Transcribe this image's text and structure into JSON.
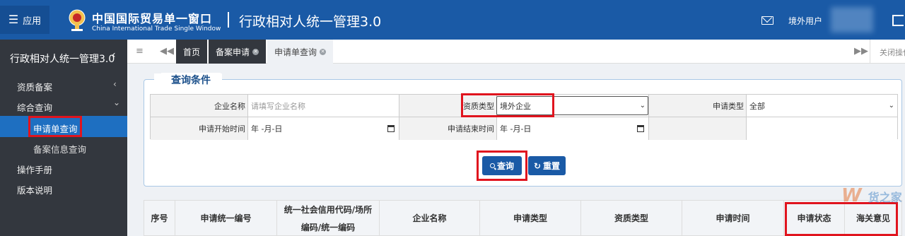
{
  "topbar": {
    "app_label": "应用",
    "brand_cn": "中国国际贸易单一窗口",
    "brand_en": "China International Trade Single Window",
    "system_title": "行政相对人统一管理3.0",
    "user_label": "境外用户"
  },
  "sidebar": {
    "title": "行政相对人统一管理3.0",
    "title_chevron": "‹",
    "items": [
      {
        "label": "资质备案",
        "chevron": "‹"
      },
      {
        "label": "综合查询",
        "chevron": "⌄"
      },
      {
        "label": "申请单查询"
      },
      {
        "label": "备案信息查询"
      },
      {
        "label": "操作手册"
      },
      {
        "label": "版本说明"
      }
    ]
  },
  "tabs": {
    "home": "首页",
    "filing": "备案申请",
    "current": "申请单查询",
    "close_ops": "关闭操作"
  },
  "query": {
    "legend": "查询条件",
    "company_name_label": "企业名称",
    "company_name_placeholder": "请填写企业名称",
    "qual_type_label": "资质类型",
    "qual_type_value": "境外企业",
    "apply_type_label": "申请类型",
    "apply_type_value": "全部",
    "start_time_label": "申请开始时间",
    "start_time_value": "年 -月-日",
    "end_time_label": "申请结束时间",
    "end_time_value": "年 -月-日",
    "query_button": "查询",
    "reset_button": "重置"
  },
  "table": {
    "headers": [
      "序号",
      "申请统一编号",
      "统一社会信用代码/场所编码/统一编码",
      "企业名称",
      "申请类型",
      "资质类型",
      "申请时间",
      "申请状态",
      "海关意见"
    ]
  },
  "watermark": {
    "text": "W",
    "sub": "货之家"
  },
  "colors": {
    "brand_blue": "#1a5aa6",
    "highlight_red": "#e0141e",
    "sidebar_dark": "#33373e",
    "active_blue": "#1e6fc1"
  }
}
